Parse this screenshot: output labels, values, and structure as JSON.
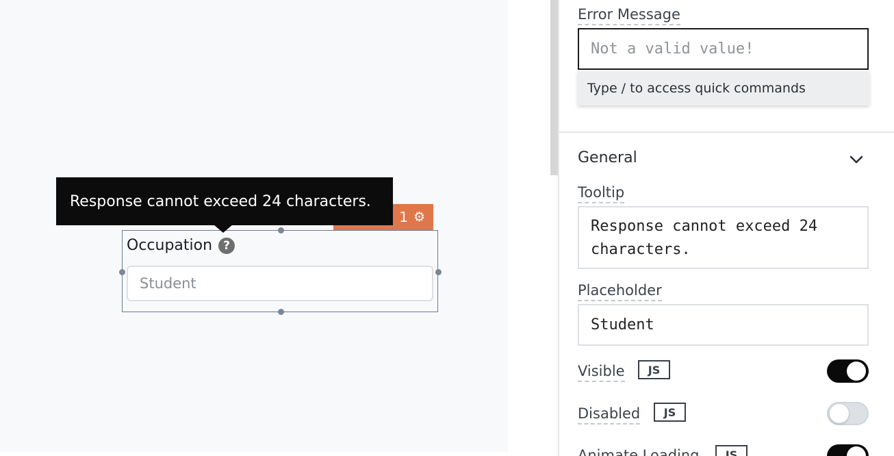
{
  "canvas": {
    "widget": {
      "label": "Occupation",
      "help_icon": "question-circle-icon",
      "placeholder": "Student",
      "tag_text": "1",
      "tag_icon": "gear-icon",
      "tag_color": "#e0774a"
    },
    "tooltip_popup": {
      "text": "Response cannot exceed 24 characters."
    }
  },
  "panel": {
    "error_message": {
      "label": "Error Message",
      "placeholder": "Not a valid value!"
    },
    "quick_commands_hint": "Type / to access quick commands",
    "general_section": {
      "title": "General",
      "chevron_icon": "chevron-down-icon"
    },
    "tooltip": {
      "label": "Tooltip",
      "value": "Response cannot exceed 24 characters."
    },
    "placeholder": {
      "label": "Placeholder",
      "value": "Student"
    },
    "visible": {
      "label": "Visible",
      "js_label": "JS",
      "on": true
    },
    "disabled": {
      "label": "Disabled",
      "js_label": "JS",
      "on": false
    },
    "animate_loading": {
      "label": "Animate Loading",
      "js_label": "JS",
      "on": true
    }
  }
}
